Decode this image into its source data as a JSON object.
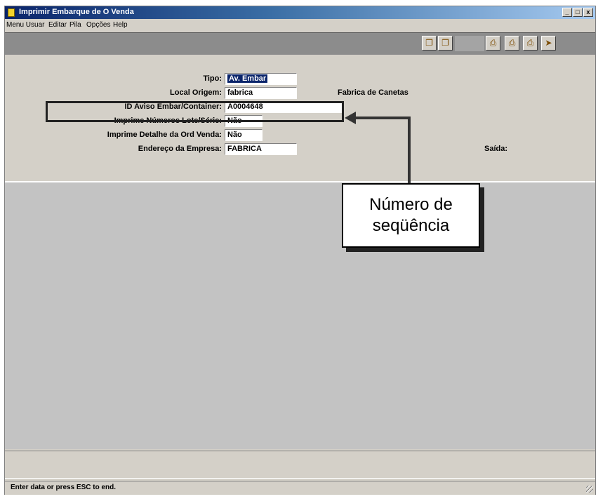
{
  "window": {
    "title": "Imprimir Embarque de O Venda",
    "controls": {
      "minimize": "_",
      "maximize": "□",
      "close": "x"
    }
  },
  "menu": [
    "Menu Usuar",
    "Editar",
    "Pila",
    "Opções",
    "Help"
  ],
  "toolbar": {
    "icons": [
      "copy-icon",
      "paste-icon",
      "print-icon",
      "print-preview-icon",
      "print-setup-icon",
      "exit-icon"
    ]
  },
  "form": {
    "tipo": {
      "label": "Tipo:",
      "value": "Av. Embar"
    },
    "local_origem": {
      "label": "Local Origem:",
      "value": "fabrica",
      "description": "Fabrica de Canetas"
    },
    "id_aviso": {
      "label": "ID Aviso Embar/Container:",
      "value": "A0004648"
    },
    "imprime_lote": {
      "label": "Imprime Números Lote/Série:",
      "value": "Não"
    },
    "imprime_detalhe": {
      "label": "Imprime Detalhe da Ord Venda:",
      "value": "Não"
    },
    "endereco": {
      "label": "Endereço da Empresa:",
      "value": "FABRICA",
      "extra_label": "Saída:"
    }
  },
  "callout": {
    "line1": "Número de",
    "line2": "seqüência"
  },
  "status": {
    "text": "Enter data or press ESC to end."
  },
  "colors": {
    "title_start": "#0a246a",
    "title_end": "#a6caf0",
    "window_bg": "#d4d0c8",
    "main_area": "#c3c3c3",
    "toolbar_bg": "#8c8c8c"
  }
}
